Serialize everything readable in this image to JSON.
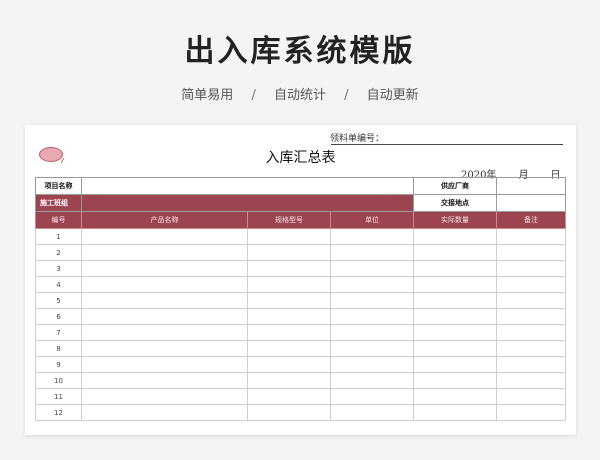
{
  "page": {
    "title": "出入库系统模版",
    "features": [
      "简单易用",
      "自动统计",
      "自动更新"
    ],
    "separator": "/"
  },
  "sheet": {
    "form_number_label": "领料单编号：",
    "title": "入库汇总表",
    "date": {
      "year": "2020年",
      "month": "月",
      "day": "日"
    },
    "info": {
      "project_label": "项目名称",
      "supplier_label": "供应厂商",
      "team_label": "施工班组",
      "delivery_label": "交接地点"
    },
    "columns": [
      "编号",
      "产品名称",
      "规格型号",
      "单位",
      "实际数量",
      "备注"
    ],
    "rows": [
      "1",
      "2",
      "3",
      "4",
      "5",
      "6",
      "7",
      "8",
      "9",
      "10",
      "11",
      "12"
    ],
    "colors": {
      "accent": "#9d4451",
      "icon": "#e9a9b0"
    }
  }
}
